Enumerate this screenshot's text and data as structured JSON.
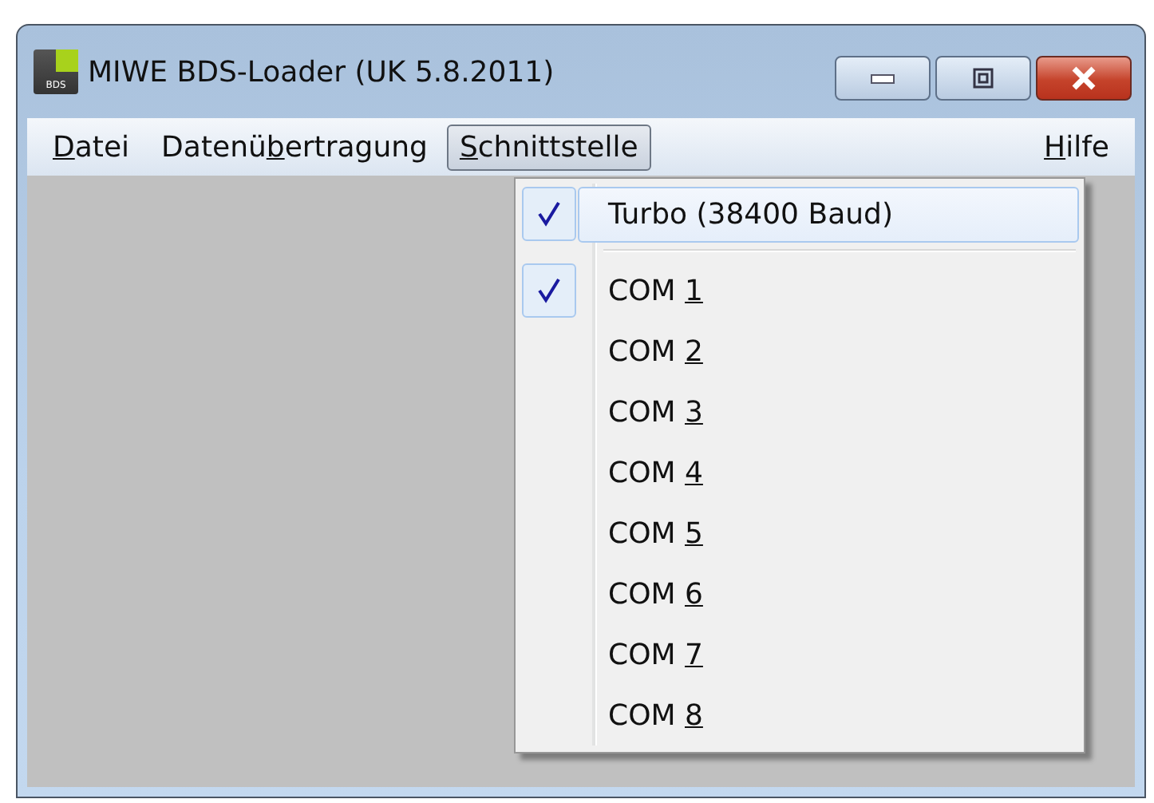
{
  "window": {
    "title": "MIWE BDS-Loader (UK 5.8.2011)",
    "app_icon_text": "BDS"
  },
  "menu_bar": {
    "left": [
      {
        "key": "D",
        "post": "atei",
        "selected": false
      },
      {
        "pre": "Datenü",
        "key": "b",
        "post": "ertragung",
        "selected": false
      },
      {
        "key": "S",
        "post": "chnittstelle",
        "selected": true
      }
    ],
    "right": [
      {
        "key": "H",
        "post": "ilfe",
        "selected": false
      }
    ]
  },
  "dropdown": {
    "groups": [
      [
        {
          "pre": "Turbo (38400 Baud)",
          "checked": true,
          "highlighted": true
        }
      ],
      [
        {
          "pre": "COM ",
          "key": "1",
          "checked": true,
          "highlighted": false
        },
        {
          "pre": "COM ",
          "key": "2",
          "checked": false,
          "highlighted": false
        },
        {
          "pre": "COM ",
          "key": "3",
          "checked": false,
          "highlighted": false
        },
        {
          "pre": "COM ",
          "key": "4",
          "checked": false,
          "highlighted": false
        },
        {
          "pre": "COM ",
          "key": "5",
          "checked": false,
          "highlighted": false
        },
        {
          "pre": "COM ",
          "key": "6",
          "checked": false,
          "highlighted": false
        },
        {
          "pre": "COM ",
          "key": "7",
          "checked": false,
          "highlighted": false
        },
        {
          "pre": "COM ",
          "key": "8",
          "checked": false,
          "highlighted": false
        }
      ]
    ]
  }
}
